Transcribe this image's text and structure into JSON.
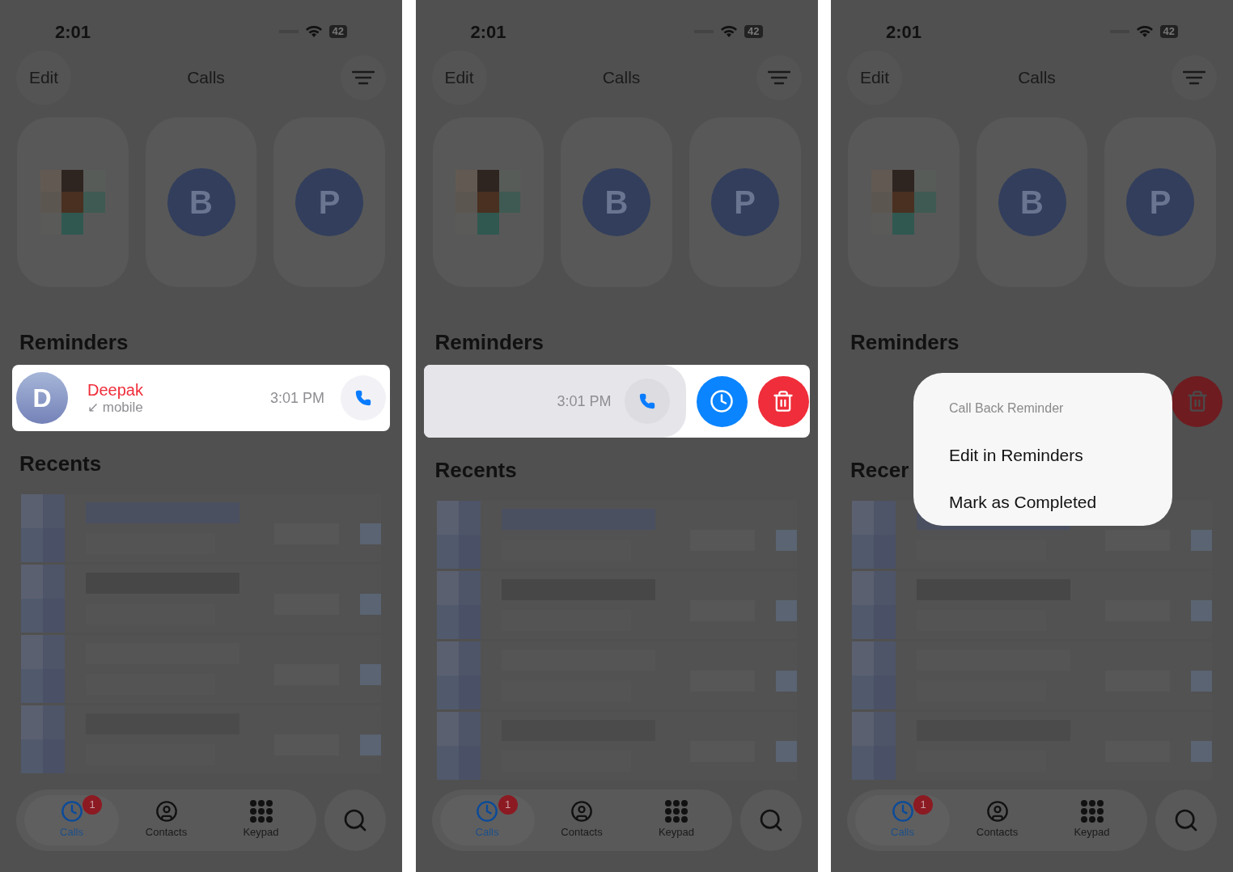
{
  "panels": [
    {
      "status": {
        "time": "2:01",
        "battery": "42"
      },
      "nav": {
        "edit": "Edit",
        "title": "Calls"
      },
      "favorites": [
        {
          "kind": "photo"
        },
        {
          "kind": "letter",
          "letter": "B"
        },
        {
          "kind": "letter",
          "letter": "P"
        }
      ],
      "reminders_title": "Reminders",
      "reminder": {
        "kind": "plain",
        "initial": "D",
        "name": "Deepak",
        "detail": "↙ mobile",
        "time": "3:01 PM"
      },
      "recents_title": "Recents",
      "tabs": [
        {
          "label": "Calls",
          "selected": true,
          "badge": "1"
        },
        {
          "label": "Contacts",
          "selected": false
        },
        {
          "label": "Keypad",
          "selected": false
        }
      ]
    },
    {
      "status": {
        "time": "2:01",
        "battery": "42"
      },
      "nav": {
        "edit": "Edit",
        "title": "Calls"
      },
      "favorites": [
        {
          "kind": "photo"
        },
        {
          "kind": "letter",
          "letter": "B"
        },
        {
          "kind": "letter",
          "letter": "P"
        }
      ],
      "reminders_title": "Reminders",
      "reminder": {
        "kind": "swiped",
        "time": "3:01 PM"
      },
      "recents_title": "Recents",
      "tabs": [
        {
          "label": "Calls",
          "selected": true,
          "badge": "1"
        },
        {
          "label": "Contacts",
          "selected": false
        },
        {
          "label": "Keypad",
          "selected": false
        }
      ]
    },
    {
      "status": {
        "time": "2:01",
        "battery": "42"
      },
      "nav": {
        "edit": "Edit",
        "title": "Calls"
      },
      "favorites": [
        {
          "kind": "photo"
        },
        {
          "kind": "letter",
          "letter": "B"
        },
        {
          "kind": "letter",
          "letter": "P"
        }
      ],
      "reminders_title": "Reminders",
      "reminder": {
        "kind": "menu"
      },
      "recents_title": "Recer",
      "menu": {
        "title": "Call Back Reminder",
        "items": [
          "Edit in Reminders",
          "Mark as Completed"
        ]
      },
      "tabs": [
        {
          "label": "Calls",
          "selected": true,
          "badge": "1"
        },
        {
          "label": "Contacts",
          "selected": false
        },
        {
          "label": "Keypad",
          "selected": false
        }
      ]
    }
  ]
}
